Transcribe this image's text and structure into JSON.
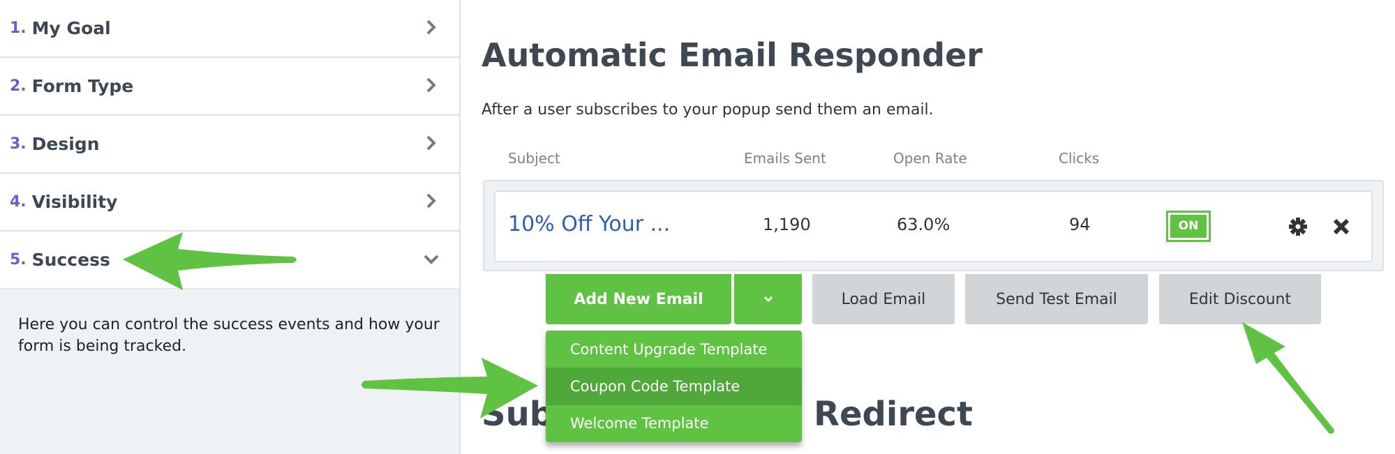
{
  "sidebar": {
    "steps": [
      {
        "num": "1.",
        "label": "My Goal",
        "icon": "chevron-right"
      },
      {
        "num": "2.",
        "label": "Form Type",
        "icon": "chevron-right"
      },
      {
        "num": "3.",
        "label": "Design",
        "icon": "chevron-right"
      },
      {
        "num": "4.",
        "label": "Visibility",
        "icon": "chevron-right"
      },
      {
        "num": "5.",
        "label": "Success",
        "icon": "chevron-down"
      }
    ],
    "panel_text": "Here you can control the success events and how your form is being tracked."
  },
  "main": {
    "title": "Automatic Email Responder",
    "subtitle": "After a user subscribes to your popup send them an email.",
    "columns": [
      "Subject",
      "Emails Sent",
      "Open Rate",
      "Clicks"
    ],
    "row": {
      "subject": "10% Off Your ...",
      "emails_sent": "1,190",
      "open_rate": "63.0%",
      "clicks": "94",
      "status": "ON"
    },
    "buttons": {
      "add": "Add New Email",
      "load": "Load Email",
      "test": "Send Test Email",
      "discount": "Edit Discount"
    },
    "dropdown": [
      "Content Upgrade Template",
      "Coupon Code Template",
      "Welcome Template"
    ],
    "heading2_start": "Sub",
    "heading2_end": "Redirect"
  },
  "colors": {
    "accent": "#5fc242",
    "step_number": "#6b5fc7",
    "link": "#2f5fb3",
    "annotation_arrow": "#5fc242"
  }
}
